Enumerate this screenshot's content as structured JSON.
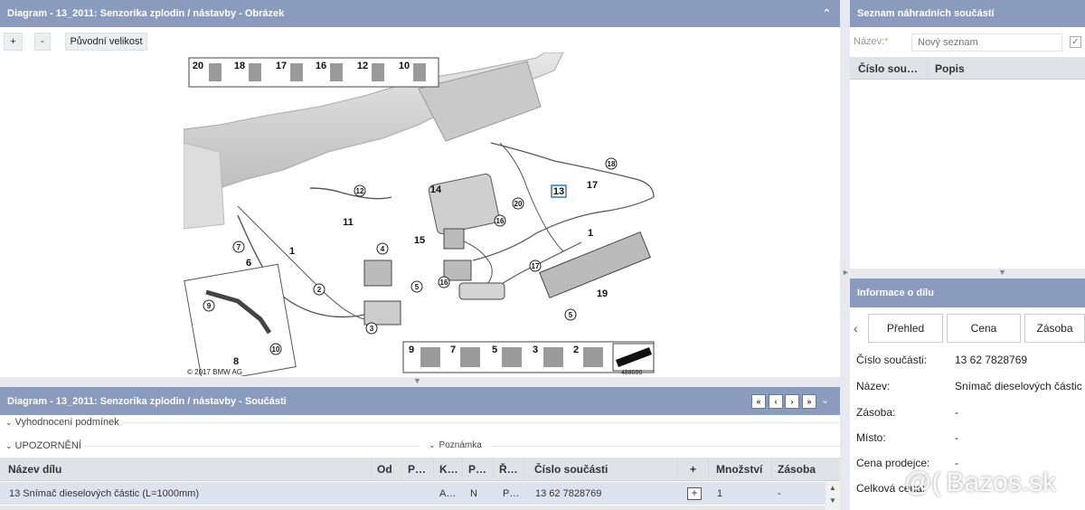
{
  "diagram_panel": {
    "title": "Diagram - 13_2011: Senzorika zplodin / nástavby - Obrázek",
    "zoom_in": "+",
    "zoom_out": "-",
    "original_size": "Původní velikost",
    "copyright": "© 2017 BMW AG",
    "image_code": "488090",
    "legend_top": [
      "20",
      "18",
      "17",
      "16",
      "12",
      "10"
    ],
    "legend_bottom": [
      "9",
      "7",
      "5",
      "3",
      "2"
    ],
    "callouts": [
      "1",
      "1",
      "2",
      "3",
      "4",
      "5",
      "5",
      "6",
      "7",
      "8",
      "9",
      "10",
      "11",
      "12",
      "13",
      "14",
      "15",
      "16",
      "16",
      "17",
      "17",
      "18",
      "19",
      "20"
    ]
  },
  "parts_list_panel": {
    "title": "Seznam náhradních součástí",
    "name_label": "Název:",
    "required_mark": "*",
    "name_placeholder": "Nový seznam",
    "columns": [
      "Číslo sou…",
      "Popis"
    ]
  },
  "part_info_panel": {
    "title": "Informace o dílu",
    "tabs": [
      "Přehled",
      "Cena",
      "Zásoba"
    ],
    "fields": [
      {
        "label": "Číslo součásti:",
        "value": "13 62 7828769"
      },
      {
        "label": "Název:",
        "value": "Snímač dieselových částic"
      },
      {
        "label": "Zásoba:",
        "value": "-"
      },
      {
        "label": "Místo:",
        "value": "-"
      },
      {
        "label": "Cena prodejce:",
        "value": "-"
      },
      {
        "label": "Celková cena:",
        "value": "-"
      }
    ]
  },
  "components_panel": {
    "title": "Diagram - 13_2011: Senzorika zplodin / nástavby - Součásti",
    "conditions_toggle": "Vyhodnocení podmínek",
    "warning_toggle": "UPOZORNĚNÍ",
    "note_toggle": "Poznámka",
    "columns": [
      "Název dílu",
      "Od",
      "P…",
      "K…",
      "P…",
      "Ř…",
      "Číslo součásti",
      "+",
      "Množství",
      "Zásoba"
    ],
    "rows": [
      {
        "name": "13 Snímač dieselových částic (L=1000mm)",
        "od": "",
        "p1": "",
        "k": "A…",
        "p2": "N",
        "r": "P…",
        "part_number": "13 62 7828769",
        "qty": "1",
        "stock": "-"
      }
    ]
  },
  "watermark": "Bazos.sk",
  "colors": {
    "header": "#8b9bbd",
    "table_header": "#dfe2e7",
    "selected_row": "#dde3ee"
  }
}
